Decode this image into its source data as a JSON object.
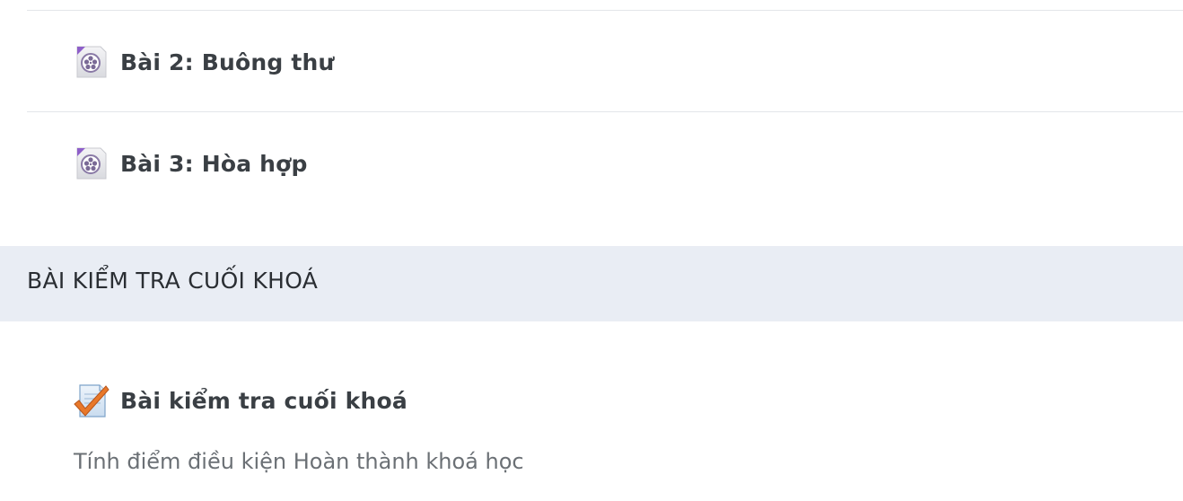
{
  "lessons": [
    {
      "title": "Bài 2: Buông thư",
      "icon": "video-file-icon"
    },
    {
      "title": "Bài 3: Hòa hợp",
      "icon": "video-file-icon"
    }
  ],
  "final_section": {
    "header": "BÀI KIỂM TRA CUỐI KHOÁ",
    "quiz": {
      "title": "Bài kiểm tra cuối khoá",
      "icon": "quiz-check-icon",
      "description": "Tính điểm điều kiện Hoàn thành khoá học"
    }
  },
  "colors": {
    "section_header_bg": "#e9edf4",
    "title_text": "#3a3f44",
    "description_text": "#6b7075",
    "divider": "#e3e6ea",
    "accent_purple": "#9b6fd0",
    "check_orange": "#e8782a"
  }
}
